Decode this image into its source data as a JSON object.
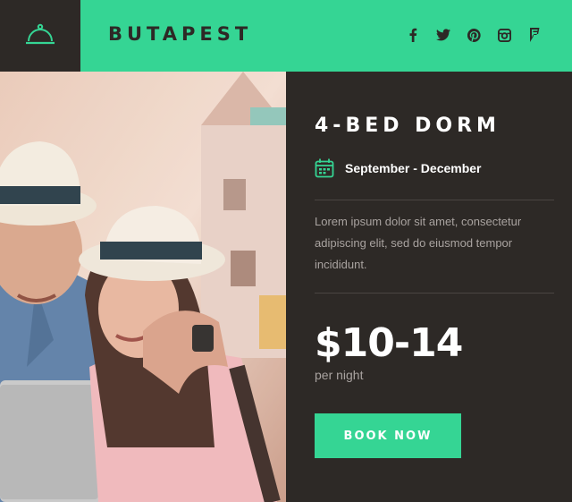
{
  "header": {
    "brand": "BUTAPEST",
    "logo_icon": "cloche-icon",
    "social": [
      {
        "name": "facebook-icon",
        "glyph": "f"
      },
      {
        "name": "twitter-icon",
        "glyph": "t"
      },
      {
        "name": "pinterest-icon",
        "glyph": "p"
      },
      {
        "name": "instagram-icon",
        "glyph": "i"
      },
      {
        "name": "foursquare-icon",
        "glyph": "4"
      }
    ]
  },
  "offer": {
    "title": "4-BED DORM",
    "dates": "September - December",
    "date_icon": "calendar-icon",
    "description": "Lorem ipsum dolor sit amet, consectetur adipiscing elit, sed do eiusmod tempor incididunt.",
    "price": "$10-14",
    "price_unit": "per night",
    "cta": "BOOK NOW"
  },
  "colors": {
    "accent": "#35d594",
    "dark": "#2d2926",
    "muted_text": "#a9a3a0"
  }
}
